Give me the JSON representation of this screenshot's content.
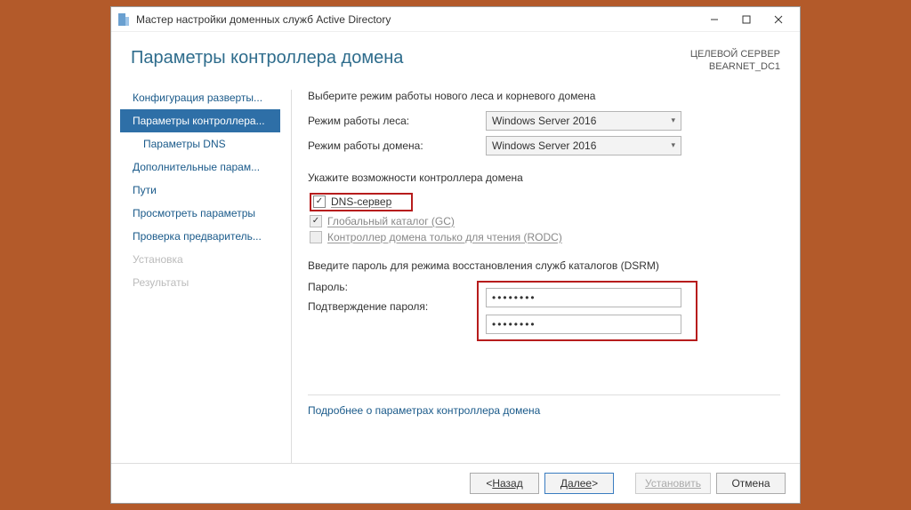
{
  "window": {
    "title": "Мастер настройки доменных служб Active Directory"
  },
  "header": {
    "pageTitle": "Параметры контроллера домена",
    "targetLabel": "ЦЕЛЕВОЙ СЕРВЕР",
    "targetServer": "BEARNET_DC1"
  },
  "sidebar": {
    "items": [
      {
        "label": "Конфигурация разверты...",
        "selected": false
      },
      {
        "label": "Параметры контроллера...",
        "selected": true
      },
      {
        "label": "Параметры DNS",
        "selected": false,
        "indent": true
      },
      {
        "label": "Дополнительные парам...",
        "selected": false
      },
      {
        "label": "Пути",
        "selected": false
      },
      {
        "label": "Просмотреть параметры",
        "selected": false
      },
      {
        "label": "Проверка предваритель...",
        "selected": false
      },
      {
        "label": "Установка",
        "selected": false,
        "disabled": true
      },
      {
        "label": "Результаты",
        "selected": false,
        "disabled": true
      }
    ]
  },
  "content": {
    "modeSection": {
      "intro": "Выберите режим работы нового леса и корневого домена",
      "forestLabel": "Режим работы леса:",
      "forestValue": "Windows Server 2016",
      "domainLabel": "Режим работы домена:",
      "domainValue": "Windows Server 2016"
    },
    "capSection": {
      "intro": "Укажите возможности контроллера домена",
      "dns": "DNS-сервер",
      "gc": "Глобальный каталог (GC)",
      "rodc": "Контроллер домена только для чтения (RODC)"
    },
    "pwSection": {
      "intro": "Введите пароль для режима восстановления служб каталогов (DSRM)",
      "pwLabel": "Пароль:",
      "pwConfirmLabel": "Подтверждение пароля:",
      "pwValue": "••••••••",
      "pwConfirmValue": "••••••••"
    },
    "moreLink": "Подробнее о параметрах контроллера домена"
  },
  "footer": {
    "back": "Назад",
    "next": "Далее",
    "install": "Установить",
    "cancel": "Отмена"
  }
}
